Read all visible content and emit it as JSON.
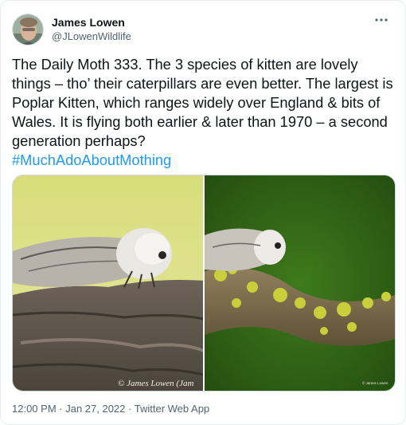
{
  "author": {
    "display_name": "James Lowen",
    "handle": "@JLowenWildlife"
  },
  "more_icon": "ellipsis-icon",
  "tweet": {
    "text": "The Daily Moth 333. The 3 species of kitten are lovely things – tho’ their caterpillars are even better. The largest is Poplar Kitten, which ranges widely over England & bits of Wales. It is flying both earlier & later than 1970 – a second generation perhaps?",
    "hashtag": "#MuchAdoAboutMothing"
  },
  "media": {
    "photo_left_watermark": "© James Lowen (Jam",
    "photo_right_watermark": "© James Lowen"
  },
  "meta": {
    "time": "12:00 PM",
    "separator": " · ",
    "date": "Jan 27, 2022",
    "source": "Twitter Web App"
  },
  "colors": {
    "link": "#1d9bf0",
    "text": "#0f1419",
    "secondary": "#536471"
  }
}
